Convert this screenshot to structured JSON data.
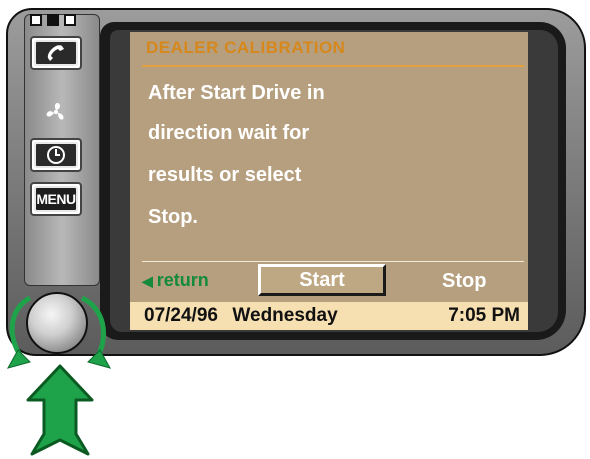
{
  "screen": {
    "title": "DEALER CALIBRATION",
    "message_lines": [
      "After Start Drive in",
      "direction wait for",
      "results or select",
      "Stop."
    ]
  },
  "actions": {
    "return_label": "return",
    "start_label": "Start",
    "stop_label": "Stop"
  },
  "status": {
    "date": "07/24/96",
    "day": "Wednesday",
    "time": "7:05 PM"
  },
  "controls": {
    "indicators": [
      "white",
      "black",
      "white"
    ],
    "phone_icon": "phone-handset-icon",
    "fan_icon": "fan-icon",
    "clock_icon": "clock-icon",
    "menu_label": "MENU",
    "knob": "rotary-knob",
    "rotate_icon": "rotate-arrows-icon",
    "push_icon": "push-up-arrow-icon"
  },
  "colors": {
    "screen_bg": "#b69f7e",
    "title": "#d6881c",
    "return": "#168a3c",
    "status_bg": "#f6dfb1",
    "arrow_green": "#1fa34a"
  }
}
